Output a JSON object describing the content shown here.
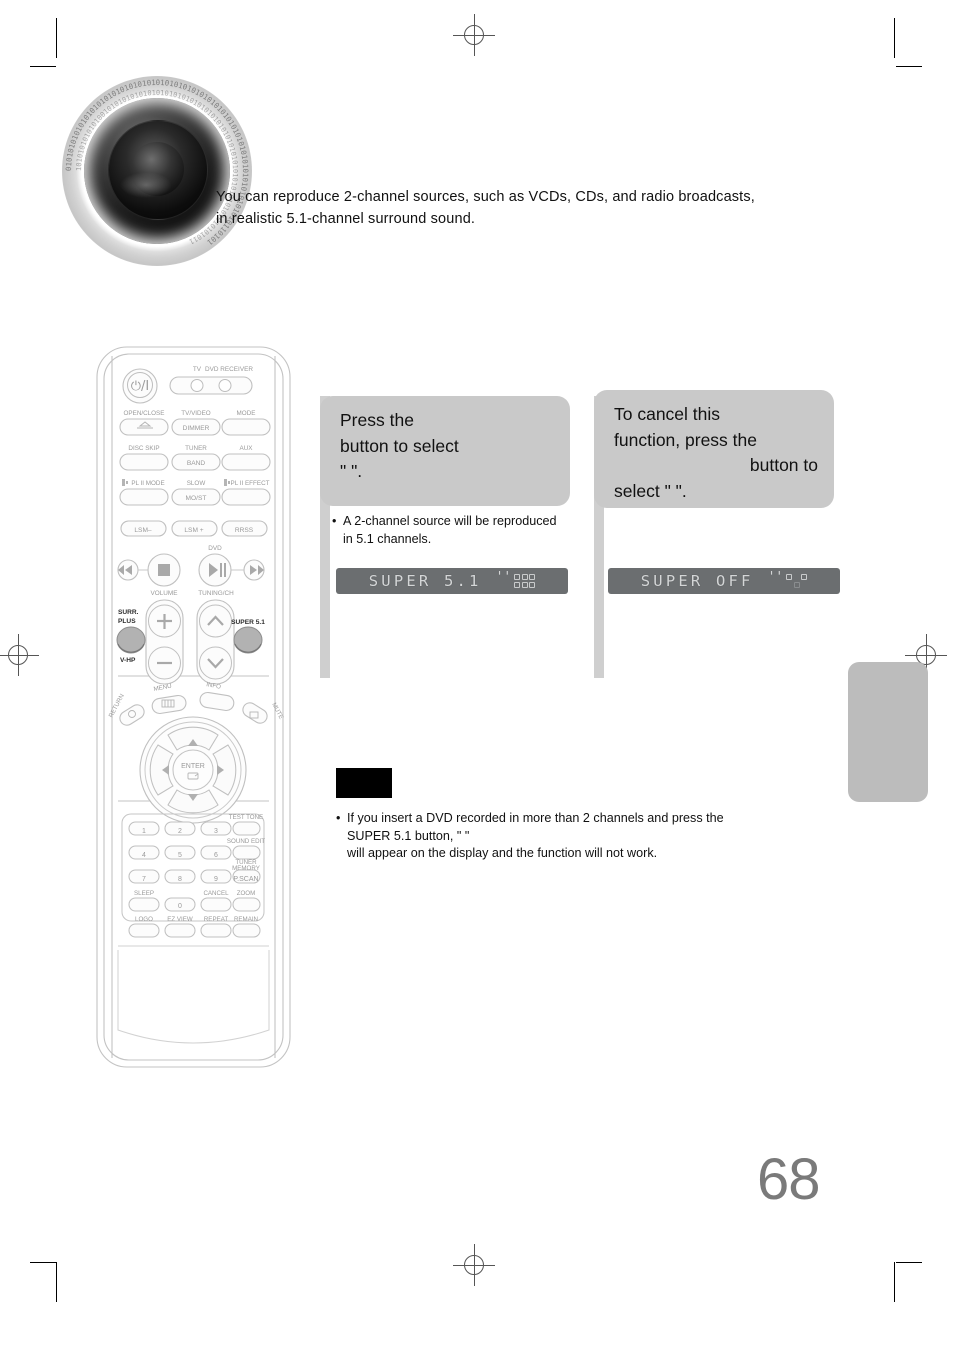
{
  "page": {
    "number": "68",
    "intro_line1": "You can reproduce 2-channel sources, such as VCDs, CDs, and radio broadcasts,",
    "intro_line2": "in realistic 5.1-channel surround sound."
  },
  "columns": [
    {
      "callout_lines": [
        "Press the",
        "button to select",
        "\"                    \"."
      ],
      "bullet_lines": [
        "A 2-channel source will be reproduced",
        "in 5.1 channels."
      ],
      "lcd": {
        "text": "SUPER 5.1",
        "speakers_on": [
          "on",
          "on",
          "on",
          "on",
          "on",
          "on"
        ]
      }
    },
    {
      "callout_lines": [
        "To cancel this",
        "function, press the",
        "button to",
        "select \"               \"."
      ],
      "bullet_lines": [],
      "lcd": {
        "text": "SUPER OFF",
        "speakers_on": [
          "on",
          "off",
          "on",
          "off",
          "off",
          "off"
        ]
      }
    }
  ],
  "note": {
    "label": "",
    "lines": [
      "If you insert a DVD recorded in more than 2 channels and press the",
      "SUPER 5.1 button, \"                                                              \"",
      "will appear on the display and the function will not work."
    ]
  },
  "remote": {
    "power_icon": "power-icon",
    "device_labels": [
      "TV",
      "DVD RECEIVER"
    ],
    "row_labels": [
      [
        "OPEN/CLOSE",
        "TV/VIDEO",
        "MODE"
      ],
      [
        "DISC SKIP",
        "TUNER",
        "AUX"
      ],
      [
        "PL II MODE",
        "SLOW",
        "PL II EFFECT"
      ]
    ],
    "inline_labels": [
      "DIMMER",
      "BAND",
      "MO/ST"
    ],
    "lsm_row": [
      "LSM–",
      "LSM +",
      "RRSS"
    ],
    "transport_label": "DVD",
    "volume_label": "VOLUME",
    "tuning_label": "TUNING/CH",
    "surr_label_1": "SURR.",
    "surr_label_2": "PLUS",
    "vhp_label": "V-HP",
    "super_label": "SUPER 5.1",
    "menu_label": "MENU",
    "info_label": "INFO",
    "return_label": "RETURN",
    "mute_label": "MUTE",
    "enter_label": "ENTER",
    "keypad": [
      "1",
      "2",
      "3",
      "4",
      "5",
      "6",
      "7",
      "8",
      "9",
      "0"
    ],
    "keypad_side_labels": [
      "TEST TONE",
      "SOUND EDIT",
      "TUNER",
      "MEMORY",
      "P.SCAN",
      "ZOOM"
    ],
    "bottom_labels": [
      "SLEEP",
      "CANCEL",
      "ZOOM",
      "LOGO",
      "EZ VIEW",
      "REPEAT",
      "REMAIN"
    ]
  },
  "colors": {
    "callout_gray": "#c9c9c9",
    "bar_gray": "#cfcfcf",
    "lcd_bg": "#6b6e70",
    "lcd_fg": "#d4d6d7",
    "page_gray": "#7a7a7a",
    "sidetab_gray": "#bcbcbc"
  }
}
